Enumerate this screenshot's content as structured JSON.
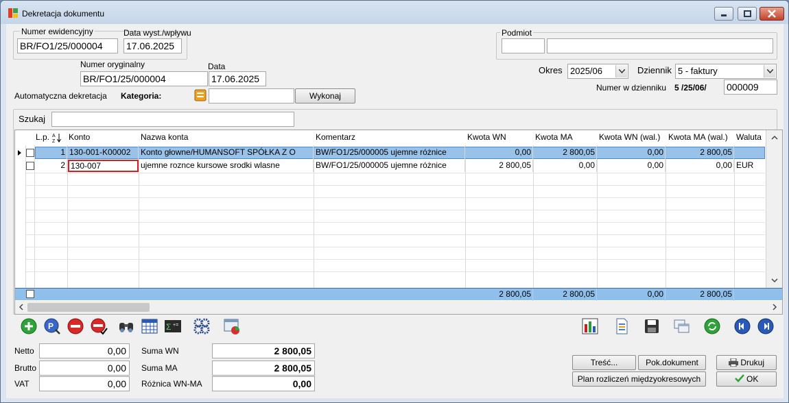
{
  "window": {
    "title": "Dekretacja dokumentu"
  },
  "header": {
    "numer_ewid_label": "Numer ewidencyjny",
    "numer_ewid_value": "BR/FO1/25/000004",
    "data_wyst_label": "Data wyst./wpływu",
    "data_wyst_value": "17.06.2025",
    "numer_oryg_label": "Numer oryginalny",
    "numer_oryg_value": "BR/FO1/25/000004",
    "data_label": "Data",
    "data_value": "17.06.2025",
    "podmiot_label": "Podmiot",
    "podmiot_code": "",
    "podmiot_name": "",
    "okres_label": "Okres",
    "okres_value": "2025/06",
    "dziennik_label": "Dziennik",
    "dziennik_value": "5 - faktury",
    "numer_dz_label": "Numer w dzienniku",
    "numer_dz_prefix": "5 /25/06/",
    "numer_dz_value": "000009",
    "auto_dekr_label": "Automatyczna dekretacja",
    "kategoria_label": "Kategoria:",
    "kategoria_value": "",
    "wykonaj_label": "Wykonaj",
    "szukaj_label": "Szukaj",
    "szukaj_value": ""
  },
  "grid": {
    "columns": [
      "L.p.",
      "Konto",
      "Nazwa konta",
      "Komentarz",
      "Kwota WN",
      "Kwota MA",
      "Kwota WN (wal.)",
      "Kwota MA (wal.)",
      "Waluta"
    ],
    "rows": [
      {
        "lp": "1",
        "konto": "130-001-K00002",
        "nazwa": "Konto głowne/HUMANSOFT SPÓŁKA Z O",
        "komentarz": "BW/FO1/25/000005 ujemne różnice",
        "wn": "0,00",
        "ma": "2 800,05",
        "wn_wal": "0,00",
        "ma_wal": "2 800,05",
        "waluta": ""
      },
      {
        "lp": "2",
        "konto": "130-007",
        "nazwa": "ujemne roznce kursowe srodki wlasne",
        "komentarz": "BW/FO1/25/000005 ujemne różnice",
        "wn": "2 800,05",
        "ma": "0,00",
        "wn_wal": "0,00",
        "ma_wal": "0,00",
        "waluta": "EUR"
      }
    ],
    "totals": {
      "wn": "2 800,05",
      "ma": "2 800,05",
      "wn_wal": "0,00",
      "ma_wal": "2 800,05"
    }
  },
  "summary": {
    "netto_label": "Netto",
    "netto_value": "0,00",
    "brutto_label": "Brutto",
    "brutto_value": "0,00",
    "vat_label": "VAT",
    "vat_value": "0,00",
    "suma_wn_label": "Suma WN",
    "suma_wn_value": "2 800,05",
    "suma_ma_label": "Suma MA",
    "suma_ma_value": "2 800,05",
    "roznica_label": "Różnica WN-MA",
    "roznica_value": "0,00"
  },
  "buttons": {
    "tresc": "Treść...",
    "pok_dokument": "Pok.dokument",
    "drukuj": "Drukuj",
    "plan": "Plan rozliczeń międzyokresowych",
    "ok": "OK"
  },
  "colors": {
    "selection": "#99c2e8",
    "totals_bar": "#8fc0ec",
    "highlight_border": "#d02020"
  }
}
